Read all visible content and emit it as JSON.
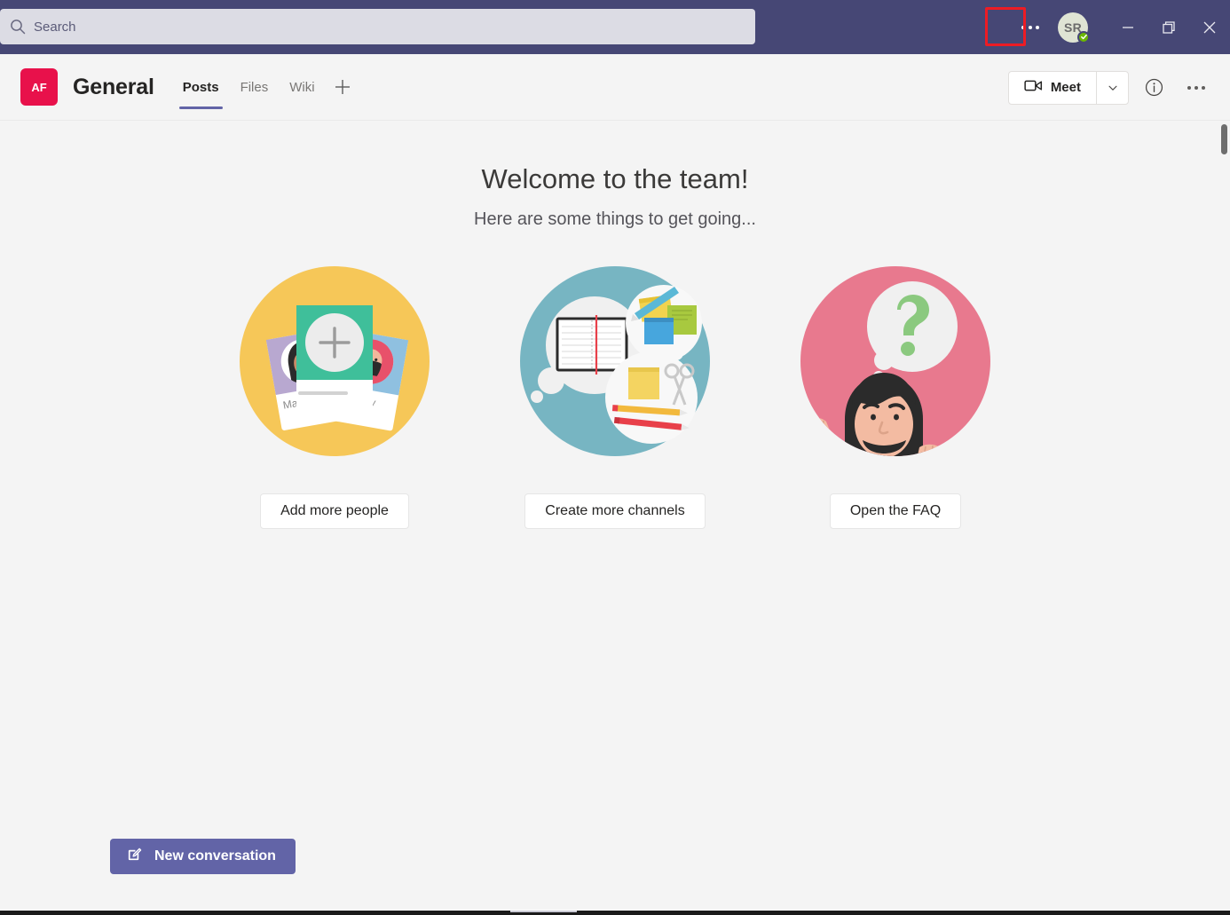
{
  "titlebar": {
    "search": {
      "placeholder": "Search",
      "value": "",
      "icon": "search-icon"
    },
    "settings_more_label": "…",
    "avatar": {
      "initials": "SR",
      "presence": "Available"
    },
    "window": {
      "minimize_label": "Minimize",
      "maximize_label": "Restore",
      "close_label": "Close"
    },
    "background_color": "#464775"
  },
  "channel_header": {
    "team_avatar_initials": "AF",
    "team_avatar_color": "#e8114b",
    "title": "General",
    "tabs": [
      {
        "label": "Posts",
        "active": true
      },
      {
        "label": "Files",
        "active": false
      },
      {
        "label": "Wiki",
        "active": false
      }
    ],
    "add_tab_label": "+",
    "meet": {
      "label": "Meet",
      "icon": "video-camera-icon",
      "chevron": "chevron-down-icon"
    },
    "info_label": "i",
    "more_label": "…",
    "accent_color": "#6264a7"
  },
  "main": {
    "title": "Welcome to the team!",
    "subtitle": "Here are some things to get going...",
    "cards": [
      {
        "illustration": "add-people-illustration",
        "circle_color": "#f6c758",
        "button_label": "Add more people",
        "name_left": "Maxine",
        "name_right": "ky"
      },
      {
        "illustration": "create-channels-illustration",
        "circle_color": "#77b5c2",
        "button_label": "Create more channels"
      },
      {
        "illustration": "faq-illustration",
        "circle_color": "#e8798e",
        "button_label": "Open the FAQ"
      }
    ]
  },
  "composer": {
    "new_conversation_label": "New conversation",
    "icon": "compose-icon",
    "color": "#6264a7"
  },
  "annotation": {
    "highlight_color": "#ed1c24",
    "target": "settings-more-button"
  }
}
